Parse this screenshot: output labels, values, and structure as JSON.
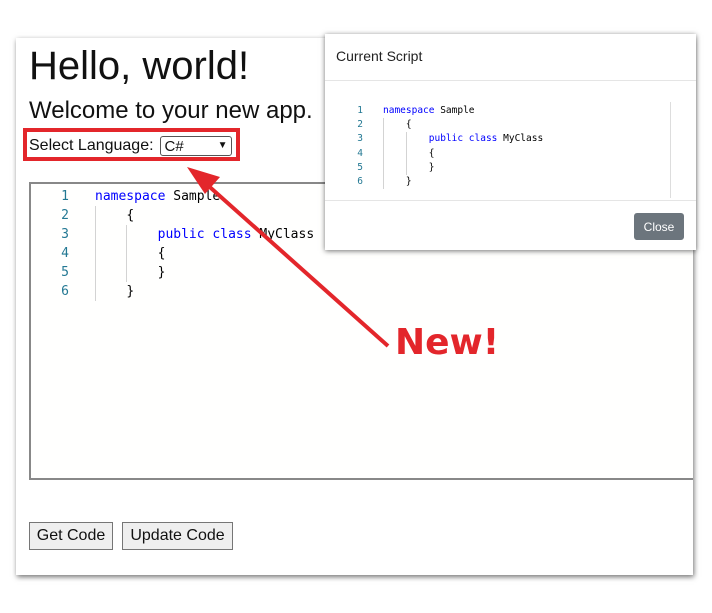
{
  "app": {
    "title": "Hello, world!",
    "subtitle": "Welcome to your new app.",
    "language_label": "Select Language:",
    "language_selected": "C#",
    "buttons": {
      "get_code": "Get Code",
      "update_code": "Update Code"
    },
    "editor": {
      "lines": [
        {
          "num": "1",
          "indent": "",
          "kw": "namespace",
          "rest": " Sample"
        },
        {
          "num": "2",
          "indent": "    ",
          "kw": "",
          "rest": "{"
        },
        {
          "num": "3",
          "indent": "        ",
          "kw": "public class",
          "rest": " MyClass"
        },
        {
          "num": "4",
          "indent": "        ",
          "kw": "",
          "rest": "{"
        },
        {
          "num": "5",
          "indent": "        ",
          "kw": "",
          "rest": "}"
        },
        {
          "num": "6",
          "indent": "    ",
          "kw": "",
          "rest": "}"
        }
      ]
    }
  },
  "modal": {
    "title": "Current Script",
    "close_label": "Close",
    "editor": {
      "lines": [
        {
          "num": "1",
          "indent": "",
          "kw": "namespace",
          "rest": " Sample"
        },
        {
          "num": "2",
          "indent": "    ",
          "kw": "",
          "rest": "{"
        },
        {
          "num": "3",
          "indent": "        ",
          "kw": "public class",
          "rest": " MyClass"
        },
        {
          "num": "4",
          "indent": "        ",
          "kw": "",
          "rest": "{"
        },
        {
          "num": "5",
          "indent": "        ",
          "kw": "",
          "rest": "}"
        },
        {
          "num": "6",
          "indent": "    ",
          "kw": "",
          "rest": "}"
        }
      ]
    }
  },
  "annotation": {
    "callout_text": "New!",
    "color": "#e3262b"
  },
  "colors": {
    "keyword": "#0000ff",
    "line_number": "#237893",
    "close_button": "#6c757d"
  },
  "icons": {
    "select_chevron": "chevron-down-icon",
    "callout_arrow": "arrow-icon"
  }
}
